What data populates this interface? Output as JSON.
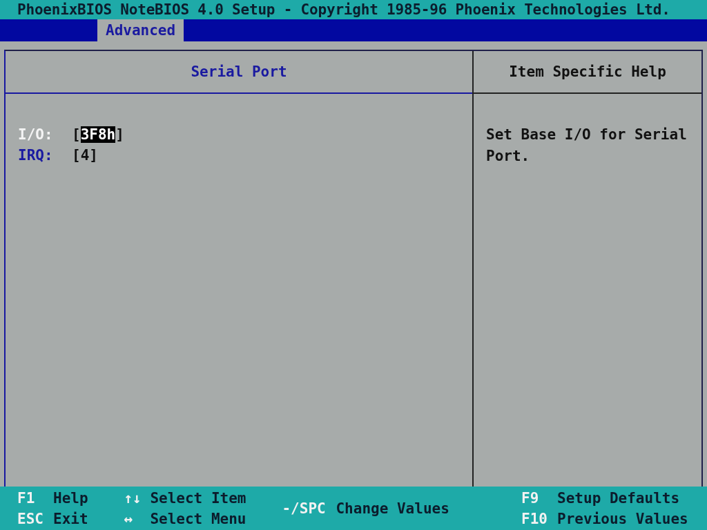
{
  "title_bar": {
    "title": "PhoenixBIOS NoteBIOS 4.0 Setup - Copyright 1985-96 Phoenix Technologies Ltd."
  },
  "menu": [
    {
      "label": "Advanced",
      "selected": true
    }
  ],
  "settings_panel": {
    "title": "Serial Port",
    "items": [
      {
        "label": "I/O:",
        "selected": true,
        "bracket_open": "[",
        "value": "3F8h",
        "bracket_close": "]"
      },
      {
        "label": "IRQ:",
        "selected": false,
        "bracket_open": "[",
        "value": "4",
        "bracket_close": "]"
      }
    ]
  },
  "help_panel": {
    "title": "Item Specific Help",
    "text": "Set Base I/O for Serial Port."
  },
  "footer": {
    "columns": [
      [
        {
          "key": "F1",
          "action": "Help"
        },
        {
          "key": "ESC",
          "action": "Exit"
        }
      ],
      [
        {
          "key": "↑↓",
          "action": "Select Item"
        },
        {
          "key": "↔",
          "action": "Select Menu"
        }
      ],
      [
        {
          "key": "-/SPC",
          "action": "Change Values"
        }
      ],
      [
        {
          "key": "F9",
          "action": "Setup Defaults"
        },
        {
          "key": "F10",
          "action": "Previous Values"
        }
      ]
    ]
  }
}
